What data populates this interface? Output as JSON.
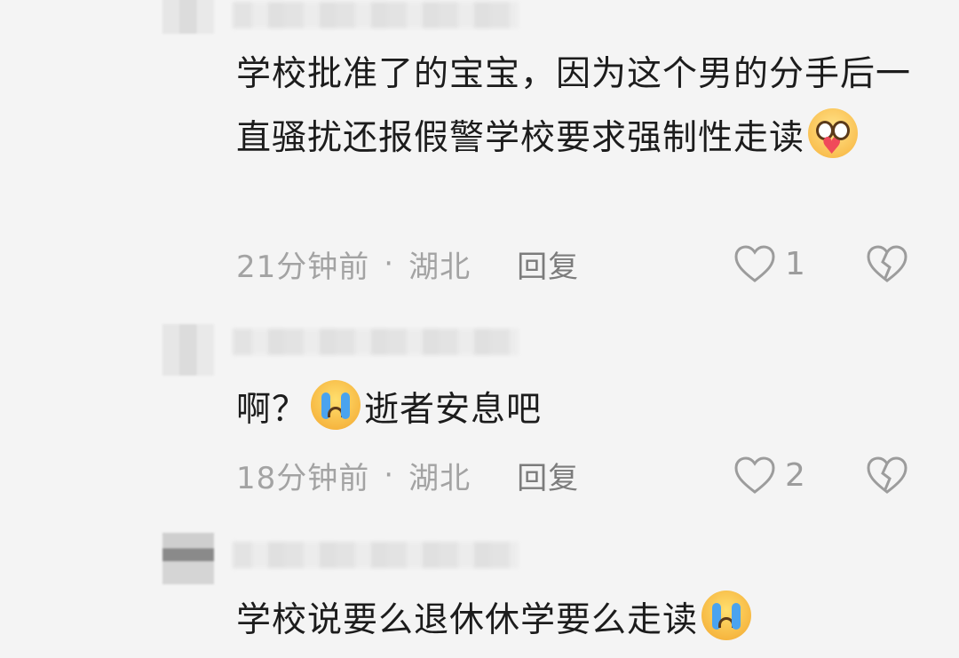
{
  "comments": [
    {
      "text_part1": "学校批准了的宝宝，因为这个男的分手后一直骚扰还报假警学校要求强制性走读",
      "emoji": "heart-hug-emoji",
      "time": "21分钟前",
      "separator": "·",
      "location": "湖北",
      "reply_label": "回复",
      "likes": "1"
    },
    {
      "text_part1": "啊？",
      "emoji": "crying-emoji",
      "text_part2": "逝者安息吧",
      "time": "18分钟前",
      "separator": "·",
      "location": "湖北",
      "reply_label": "回复",
      "likes": "2"
    },
    {
      "text_part1": "学校说要么退休休学要么走读",
      "emoji": "crying-emoji"
    }
  ],
  "colors": {
    "background": "#f4f4f4",
    "text": "#1c1c1c",
    "meta": "#a3a3a3",
    "icon": "#9c9c9c"
  }
}
